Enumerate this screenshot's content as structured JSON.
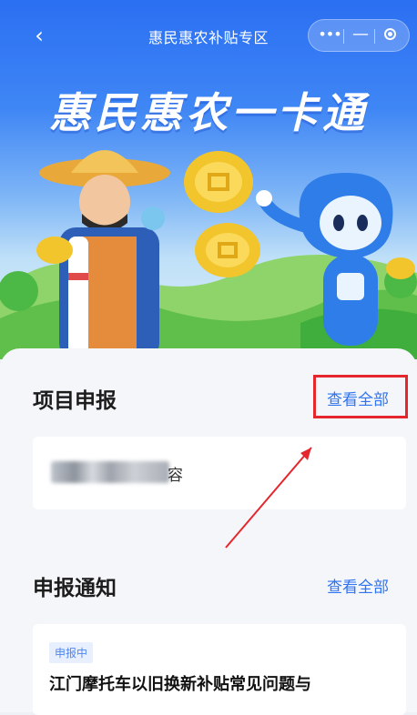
{
  "nav": {
    "back_icon": "‹",
    "title": "惠民惠农补贴专区",
    "more_icon": "•••",
    "minimize_icon": "—"
  },
  "banner": {
    "title": "惠民惠农一卡通"
  },
  "project_section": {
    "title": "项目申报",
    "view_all": "查看全部",
    "card_text": "容"
  },
  "notice_section": {
    "title": "申报通知",
    "view_all": "查看全部",
    "item": {
      "badge": "申报中",
      "title": "江门摩托车以旧换新补贴常见问题与"
    }
  },
  "colors": {
    "accent": "#2f74f0",
    "highlight_red": "#e5262d"
  }
}
